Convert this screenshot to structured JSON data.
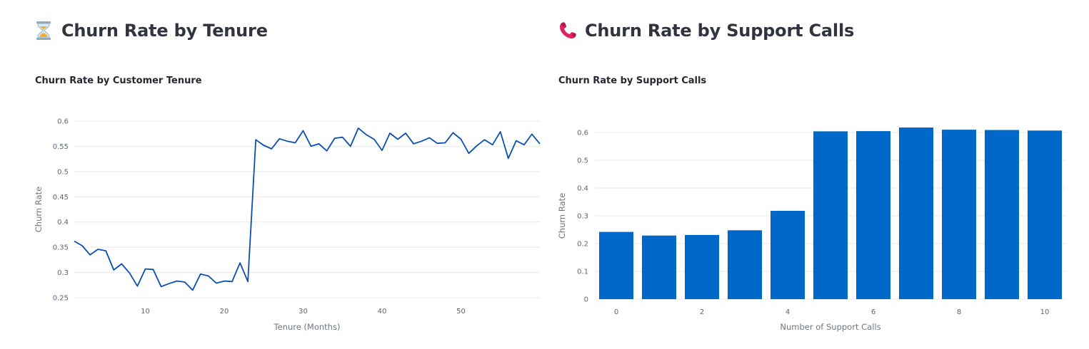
{
  "left": {
    "section_title": "Churn Rate by Tenure",
    "icon": "hourglass-icon",
    "chart_data": {
      "type": "line",
      "title": "Churn Rate by Customer Tenure",
      "xlabel": "Tenure (Months)",
      "ylabel": "Churn Rate",
      "x": [
        1,
        2,
        3,
        4,
        5,
        6,
        7,
        8,
        9,
        10,
        11,
        12,
        13,
        14,
        15,
        16,
        17,
        18,
        19,
        20,
        21,
        22,
        23,
        24,
        25,
        26,
        27,
        28,
        29,
        30,
        31,
        32,
        33,
        34,
        35,
        36,
        37,
        38,
        39,
        40,
        41,
        42,
        43,
        44,
        45,
        46,
        47,
        48,
        49,
        50,
        51,
        52,
        53,
        54,
        55,
        56,
        57,
        58,
        59,
        60
      ],
      "series": [
        {
          "values": [
            0.362,
            0.353,
            0.335,
            0.346,
            0.343,
            0.305,
            0.317,
            0.299,
            0.273,
            0.307,
            0.306,
            0.272,
            0.278,
            0.283,
            0.281,
            0.265,
            0.297,
            0.293,
            0.279,
            0.283,
            0.282,
            0.319,
            0.282,
            0.563,
            0.552,
            0.545,
            0.565,
            0.56,
            0.557,
            0.581,
            0.55,
            0.555,
            0.541,
            0.566,
            0.568,
            0.55,
            0.586,
            0.573,
            0.564,
            0.542,
            0.576,
            0.564,
            0.576,
            0.555,
            0.56,
            0.567,
            0.556,
            0.557,
            0.577,
            0.564,
            0.536,
            0.551,
            0.563,
            0.553,
            0.579,
            0.526,
            0.561,
            0.553,
            0.574,
            0.555
          ],
          "color": "#0a4fb0"
        }
      ],
      "xlim": [
        1,
        60
      ],
      "ylim": [
        0.25,
        0.6
      ],
      "xticks": [
        10,
        20,
        30,
        40,
        50
      ],
      "yticks": [
        0.25,
        0.3,
        0.35,
        0.4,
        0.45,
        0.5,
        0.55,
        0.6
      ],
      "ytick_labels": [
        "0.25",
        "0.3",
        "0.35",
        "0.4",
        "0.45",
        "0.5",
        "0.55",
        "0.6"
      ],
      "grid": true
    }
  },
  "right": {
    "section_title": "Churn Rate by Support Calls",
    "icon": "telephone-icon",
    "chart_data": {
      "type": "bar",
      "title": "Churn Rate by Support Calls",
      "xlabel": "Number of Support Calls",
      "ylabel": "Churn Rate",
      "categories": [
        0,
        1,
        2,
        3,
        4,
        5,
        6,
        7,
        8,
        9,
        10
      ],
      "values": [
        0.242,
        0.229,
        0.231,
        0.248,
        0.318,
        0.604,
        0.605,
        0.618,
        0.61,
        0.609,
        0.607
      ],
      "color": "#0068c9",
      "ylim": [
        0,
        0.6
      ],
      "xticks": [
        0,
        2,
        4,
        6,
        8,
        10
      ],
      "yticks": [
        0,
        0.1,
        0.2,
        0.3,
        0.4,
        0.5,
        0.6
      ],
      "ytick_labels": [
        "0",
        "0.1",
        "0.2",
        "0.3",
        "0.4",
        "0.5",
        "0.6"
      ],
      "grid": true
    }
  }
}
